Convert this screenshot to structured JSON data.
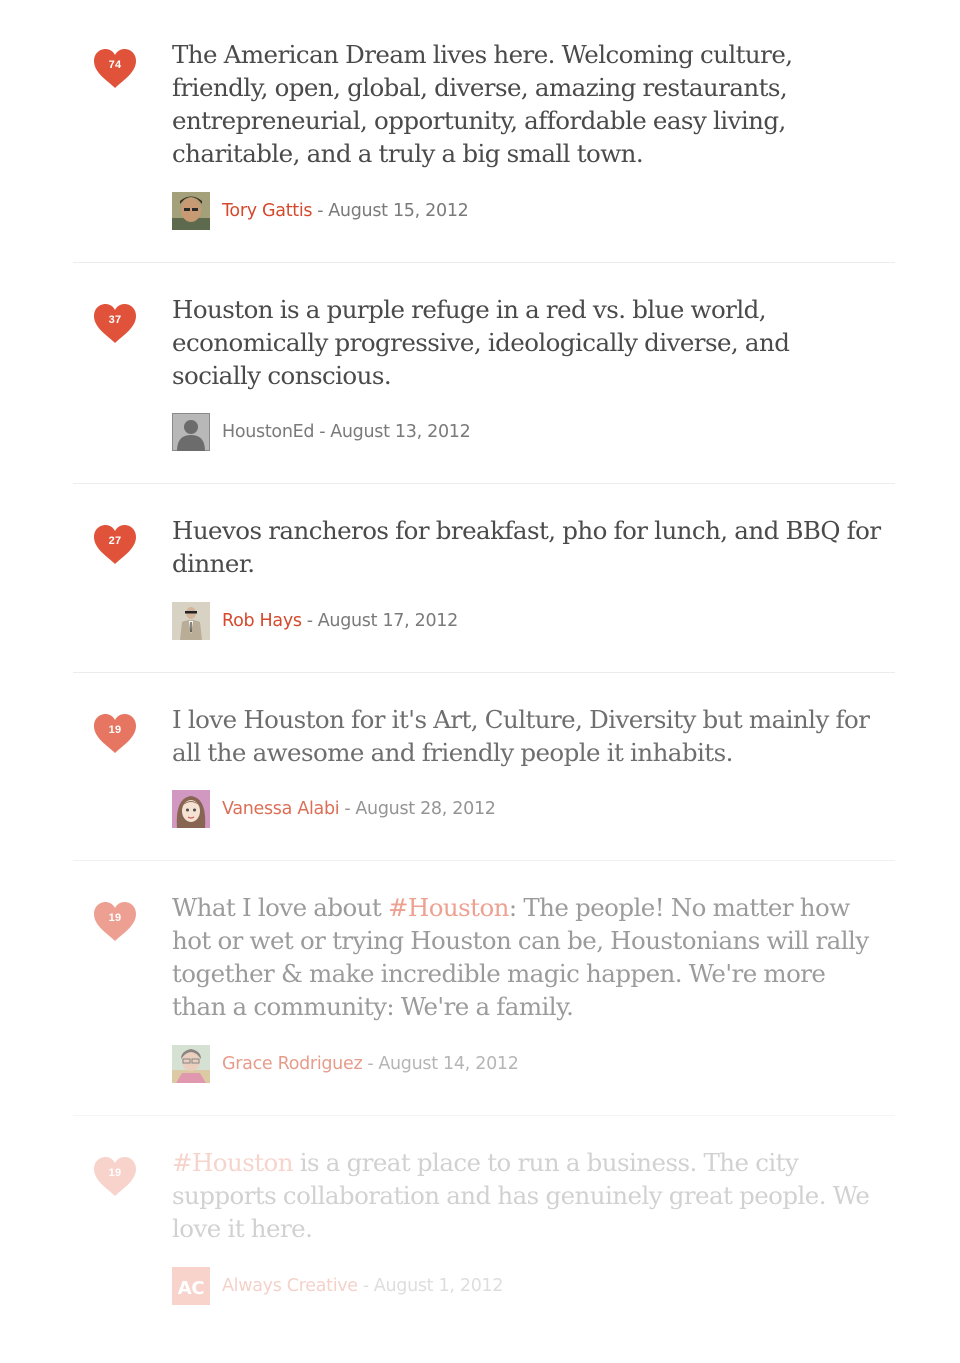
{
  "colors": {
    "heart": "#e0533a",
    "link": "#d54a2c",
    "text": "#4a4a4a",
    "meta": "#7a7a7a",
    "divider": "#ececec"
  },
  "byline_separator": "-",
  "posts": [
    {
      "likes": "74",
      "segments": [
        {
          "text": "The American Dream lives here. Welcoming culture, friendly, open, global, diverse, amazing restaurants, entrepreneurial, opportunity, affordable easy living, charitable, and a truly a big small town."
        }
      ],
      "author": "Tory Gattis",
      "date": "August 15, 2012",
      "avatar": "person-photo",
      "opacity": 1
    },
    {
      "likes": "37",
      "segments": [
        {
          "text": "Houston is a purple refuge in a red vs. blue world, economically progressive, ideologically diverse, and socially conscious."
        }
      ],
      "author": "HoustonEd",
      "date": "August 13, 2012",
      "avatar": "default-silhouette",
      "opacity": 1
    },
    {
      "likes": "27",
      "segments": [
        {
          "text": "Huevos rancheros for breakfast, pho for lunch, and BBQ for dinner."
        }
      ],
      "author": "Rob Hays",
      "date": "August 17, 2012",
      "avatar": "person-suit-photo",
      "opacity": 1
    },
    {
      "likes": "19",
      "segments": [
        {
          "text": "I love Houston for it's Art, Culture, Diversity but mainly for all the awesome and friendly people it inhabits."
        }
      ],
      "author": "Vanessa Alabi",
      "date": "August 28, 2012",
      "avatar": "cartoon-girl",
      "opacity": 0.8
    },
    {
      "likes": "19",
      "segments": [
        {
          "text": "What I love about "
        },
        {
          "text": "#Houston",
          "hashtag": true
        },
        {
          "text": ": The people! No matter how hot or wet or trying Houston can be, Houstonians will rally together & make incredible magic happen. We're more than a community: We're a family."
        }
      ],
      "author": "Grace Rodriguez",
      "date": "August 14, 2012",
      "avatar": "person-photo-colorful",
      "opacity": 0.55
    },
    {
      "likes": "19",
      "segments": [
        {
          "text": "#Houston",
          "hashtag": true
        },
        {
          "text": " is a great place to run a business. The city supports collaboration and has genuinely great people. We love it here."
        }
      ],
      "author": "Always Creative",
      "date": "August 1, 2012",
      "avatar": "ac-logo",
      "avatar_text": "AC",
      "opacity": 0.25
    }
  ]
}
